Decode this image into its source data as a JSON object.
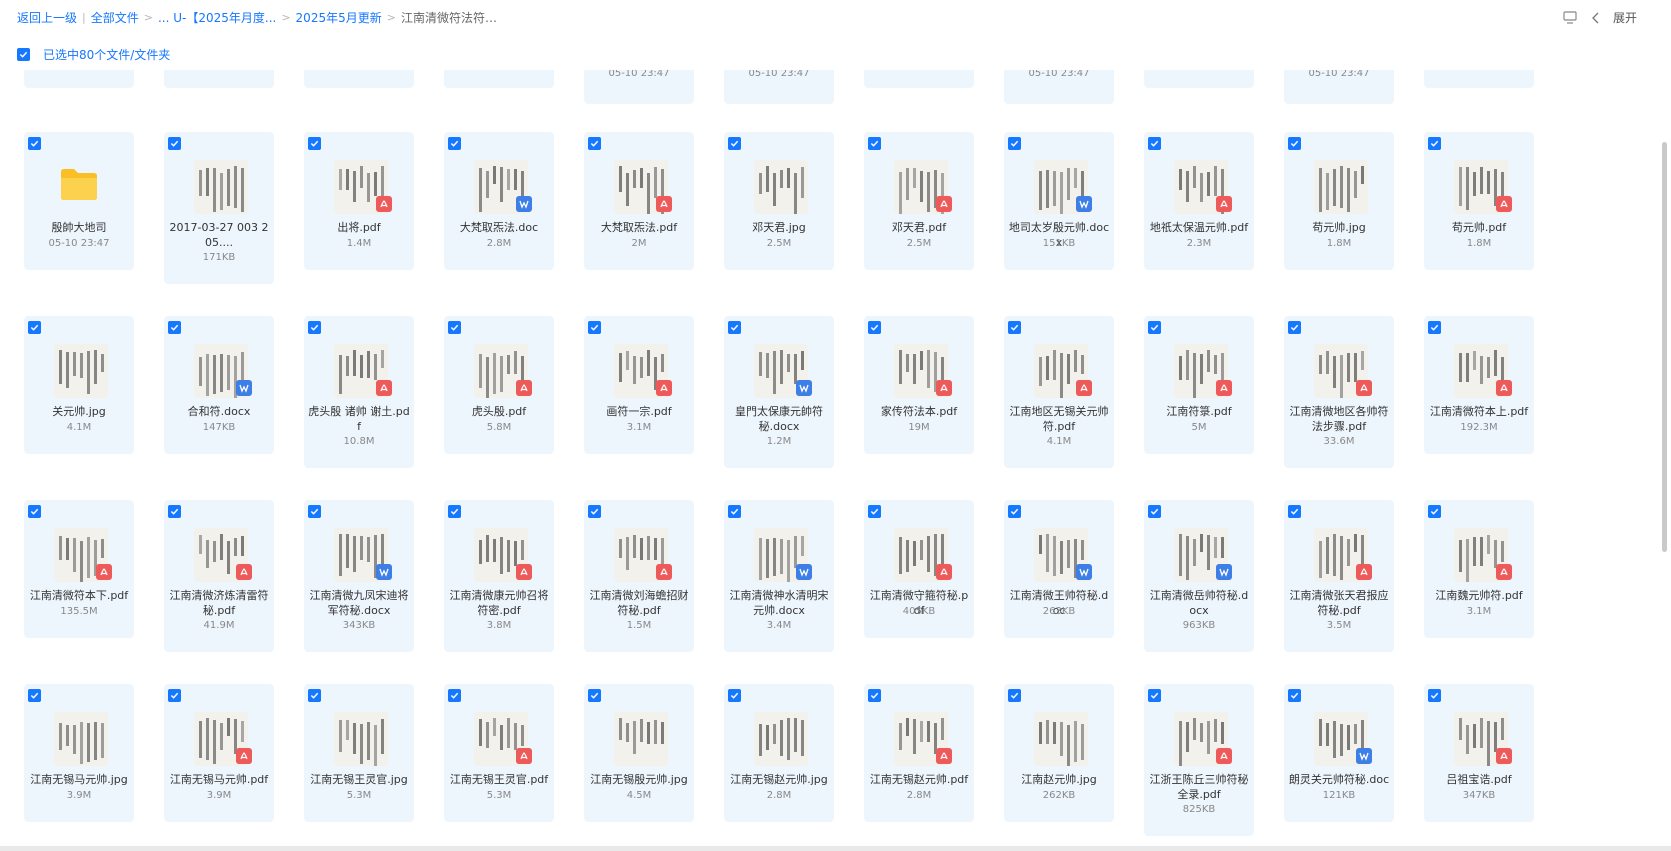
{
  "breadcrumb": {
    "back": "返回上一级",
    "root": "全部文件",
    "level2": "... U-【2025年月度...",
    "level3": "2025年5月更新",
    "current": "江南清微符法符箓..."
  },
  "toolbar": {
    "expand_label": "展开"
  },
  "selection": {
    "label": "已选中80个文件/文件夹"
  },
  "colors": {
    "accent": "#1677ff",
    "pdf": "#ee5a5a",
    "word": "#3d7fe6",
    "folder": "#f9bf25",
    "tile": "#eef6fd"
  },
  "top_partial_row": [
    {
      "col": 0,
      "size": ""
    },
    {
      "col": 1,
      "size": ""
    },
    {
      "col": 2,
      "size": ""
    },
    {
      "col": 3,
      "size": ""
    },
    {
      "col": 4,
      "size": "05-10 23:47"
    },
    {
      "col": 5,
      "size": "05-10 23:47"
    },
    {
      "col": 6,
      "size": ""
    },
    {
      "col": 7,
      "size": "05-10 23:47"
    },
    {
      "col": 8,
      "size": ""
    },
    {
      "col": 9,
      "size": "05-10 23:47"
    },
    {
      "col": 10,
      "size": ""
    }
  ],
  "rows": [
    [
      {
        "name": "殷帥大地司",
        "meta": "05-10 23:47",
        "type": "folder"
      },
      {
        "name": "2017-03-27 003 205....",
        "meta": "171KB",
        "type": "image"
      },
      {
        "name": "出将.pdf",
        "meta": "1.4M",
        "type": "pdf"
      },
      {
        "name": "大梵取炁法.doc",
        "meta": "2.8M",
        "type": "word"
      },
      {
        "name": "大梵取炁法.pdf",
        "meta": "2M",
        "type": "pdf"
      },
      {
        "name": "邓天君.jpg",
        "meta": "2.5M",
        "type": "image"
      },
      {
        "name": "邓天君.pdf",
        "meta": "2.5M",
        "type": "pdf"
      },
      {
        "name": "地司太岁殷元帅.docx",
        "meta": "151KB",
        "type": "word"
      },
      {
        "name": "地祇太保温元帅.pdf",
        "meta": "2.3M",
        "type": "pdf"
      },
      {
        "name": "苟元帅.jpg",
        "meta": "1.8M",
        "type": "image"
      },
      {
        "name": "苟元帅.pdf",
        "meta": "1.8M",
        "type": "pdf"
      }
    ],
    [
      {
        "name": "关元帅.jpg",
        "meta": "4.1M",
        "type": "image"
      },
      {
        "name": "合和符.docx",
        "meta": "147KB",
        "type": "word"
      },
      {
        "name": "虎头殷 诸帅 谢土.pdf",
        "meta": "10.8M",
        "type": "pdf"
      },
      {
        "name": "虎头殷.pdf",
        "meta": "5.8M",
        "type": "pdf"
      },
      {
        "name": "画符一宗.pdf",
        "meta": "3.1M",
        "type": "pdf"
      },
      {
        "name": "皇門太保康元帥符秘.docx",
        "meta": "1.2M",
        "type": "word"
      },
      {
        "name": "家传符法本.pdf",
        "meta": "19M",
        "type": "pdf"
      },
      {
        "name": "江南地区无锡关元帅符.pdf",
        "meta": "4.1M",
        "type": "pdf"
      },
      {
        "name": "江南符箓.pdf",
        "meta": "5M",
        "type": "pdf"
      },
      {
        "name": "江南清微地区各帅符法步骤.pdf",
        "meta": "33.6M",
        "type": "pdf"
      },
      {
        "name": "江南清微符本上.pdf",
        "meta": "192.3M",
        "type": "pdf"
      }
    ],
    [
      {
        "name": "江南清微符本下.pdf",
        "meta": "135.5M",
        "type": "pdf"
      },
      {
        "name": "江南清微济炼清雷符秘.pdf",
        "meta": "41.9M",
        "type": "pdf"
      },
      {
        "name": "江南清微九凤宋迪将军符秘.docx",
        "meta": "343KB",
        "type": "word"
      },
      {
        "name": "江南清微康元帅召将符密.pdf",
        "meta": "3.8M",
        "type": "pdf"
      },
      {
        "name": "江南清微刘海蟾招财符秘.pdf",
        "meta": "1.5M",
        "type": "pdf"
      },
      {
        "name": "江南清微神水清明宋元帅.docx",
        "meta": "3.4M",
        "type": "word"
      },
      {
        "name": "江南清微守箍符秘.pdf",
        "meta": "405KB",
        "type": "pdf"
      },
      {
        "name": "江南清微王帅符秘.doc",
        "meta": "263KB",
        "type": "word"
      },
      {
        "name": "江南清微岳帅符秘.docx",
        "meta": "963KB",
        "type": "word"
      },
      {
        "name": "江南清微张天君报应符秘.pdf",
        "meta": "3.5M",
        "type": "pdf"
      },
      {
        "name": "江南魏元帅符.pdf",
        "meta": "3.1M",
        "type": "pdf"
      }
    ],
    [
      {
        "name": "江南无锡马元帅.jpg",
        "meta": "3.9M",
        "type": "image"
      },
      {
        "name": "江南无锡马元帅.pdf",
        "meta": "3.9M",
        "type": "pdf"
      },
      {
        "name": "江南无锡王灵官.jpg",
        "meta": "5.3M",
        "type": "image"
      },
      {
        "name": "江南无锡王灵官.pdf",
        "meta": "5.3M",
        "type": "pdf"
      },
      {
        "name": "江南无锡殷元帅.jpg",
        "meta": "4.5M",
        "type": "image"
      },
      {
        "name": "江南无锡赵元帅.jpg",
        "meta": "2.8M",
        "type": "image"
      },
      {
        "name": "江南无锡赵元帅.pdf",
        "meta": "2.8M",
        "type": "pdf"
      },
      {
        "name": "江南赵元帅.jpg",
        "meta": "262KB",
        "type": "image"
      },
      {
        "name": "江浙王陈丘三帅符秘全录.pdf",
        "meta": "825KB",
        "type": "pdf"
      },
      {
        "name": "朗灵关元帅符秘.doc",
        "meta": "121KB",
        "type": "word"
      },
      {
        "name": "吕祖宝诰.pdf",
        "meta": "347KB",
        "type": "pdf"
      }
    ]
  ]
}
